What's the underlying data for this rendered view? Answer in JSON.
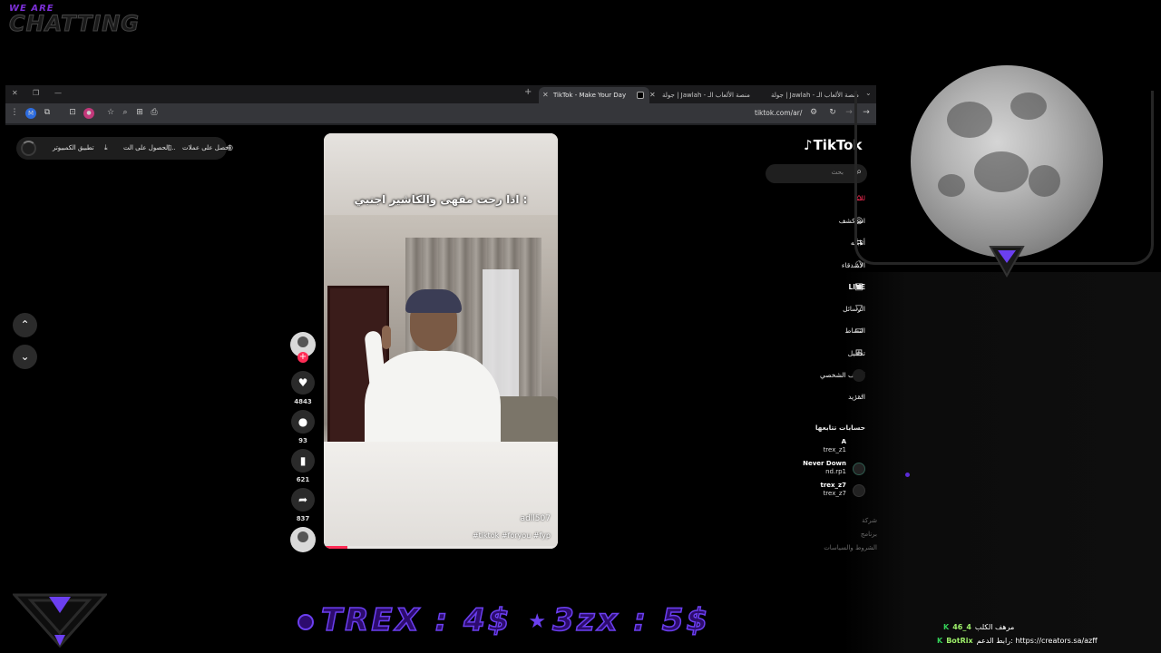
{
  "overlay": {
    "brand_small": "WE ARE",
    "brand_big": "CHATTING",
    "ticker_part1": "TREX : 4$",
    "ticker_part2": "3zx : 5$",
    "accent_color": "#6b3ff0"
  },
  "browser": {
    "tabs": [
      {
        "label": "TikTok - Make Your Day",
        "active": true
      },
      {
        "label": "جولة | Jawlah - منصة الألعاب الـ",
        "active": false
      },
      {
        "label": "جولة | Jawlah - منصة الألعاب الـ",
        "active": false
      }
    ],
    "new_tab": "+",
    "url": "tiktok.com/ar/"
  },
  "promo": {
    "coins": "احصل على عملات",
    "get_app": "الحصول على الت...",
    "desktop_app": "تطبيق الكمبيوتر"
  },
  "video": {
    "caption": "اذا رحت مقهى والكاشير اجنبي :",
    "username": "adll507",
    "hashtags": "#tiktok #foryou #fyp",
    "progress": 0.1
  },
  "actions": {
    "likes": "4843",
    "comments": "93",
    "saves": "621",
    "shares": "837"
  },
  "sidebar": {
    "logo": "TikTok",
    "search_placeholder": "بحث",
    "nav": [
      {
        "label": "لك",
        "icon": "home-icon"
      },
      {
        "label": "استكشف",
        "icon": "compass-icon"
      },
      {
        "label": "أتابعه",
        "icon": "following-icon"
      },
      {
        "label": "الأصدقاء",
        "icon": "friends-icon"
      },
      {
        "label": "LIVE",
        "icon": "live-icon"
      },
      {
        "label": "الرسائل",
        "icon": "messages-icon"
      },
      {
        "label": "النشاط",
        "icon": "activity-icon"
      },
      {
        "label": "تحميل",
        "icon": "upload-icon"
      },
      {
        "label": "الملف الشخصي",
        "icon": "profile-icon"
      },
      {
        "label": "المزيد",
        "icon": "more-icon"
      }
    ],
    "following_title": "حسابات تتابعها",
    "accounts": [
      {
        "name": "A",
        "handle": "trex_z1"
      },
      {
        "name": "Never Down",
        "handle": "nd.rp1"
      },
      {
        "name": "trex_z7",
        "handle": "trex_z7"
      }
    ],
    "footer": [
      "شركة",
      "برنامج",
      "الشروط والسياسات"
    ]
  },
  "chat": [
    {
      "user": "46_4",
      "message": "مرهف الكلب"
    },
    {
      "user": "BotRix",
      "message": "رابط الدعم: https://creators.sa/azff"
    }
  ]
}
